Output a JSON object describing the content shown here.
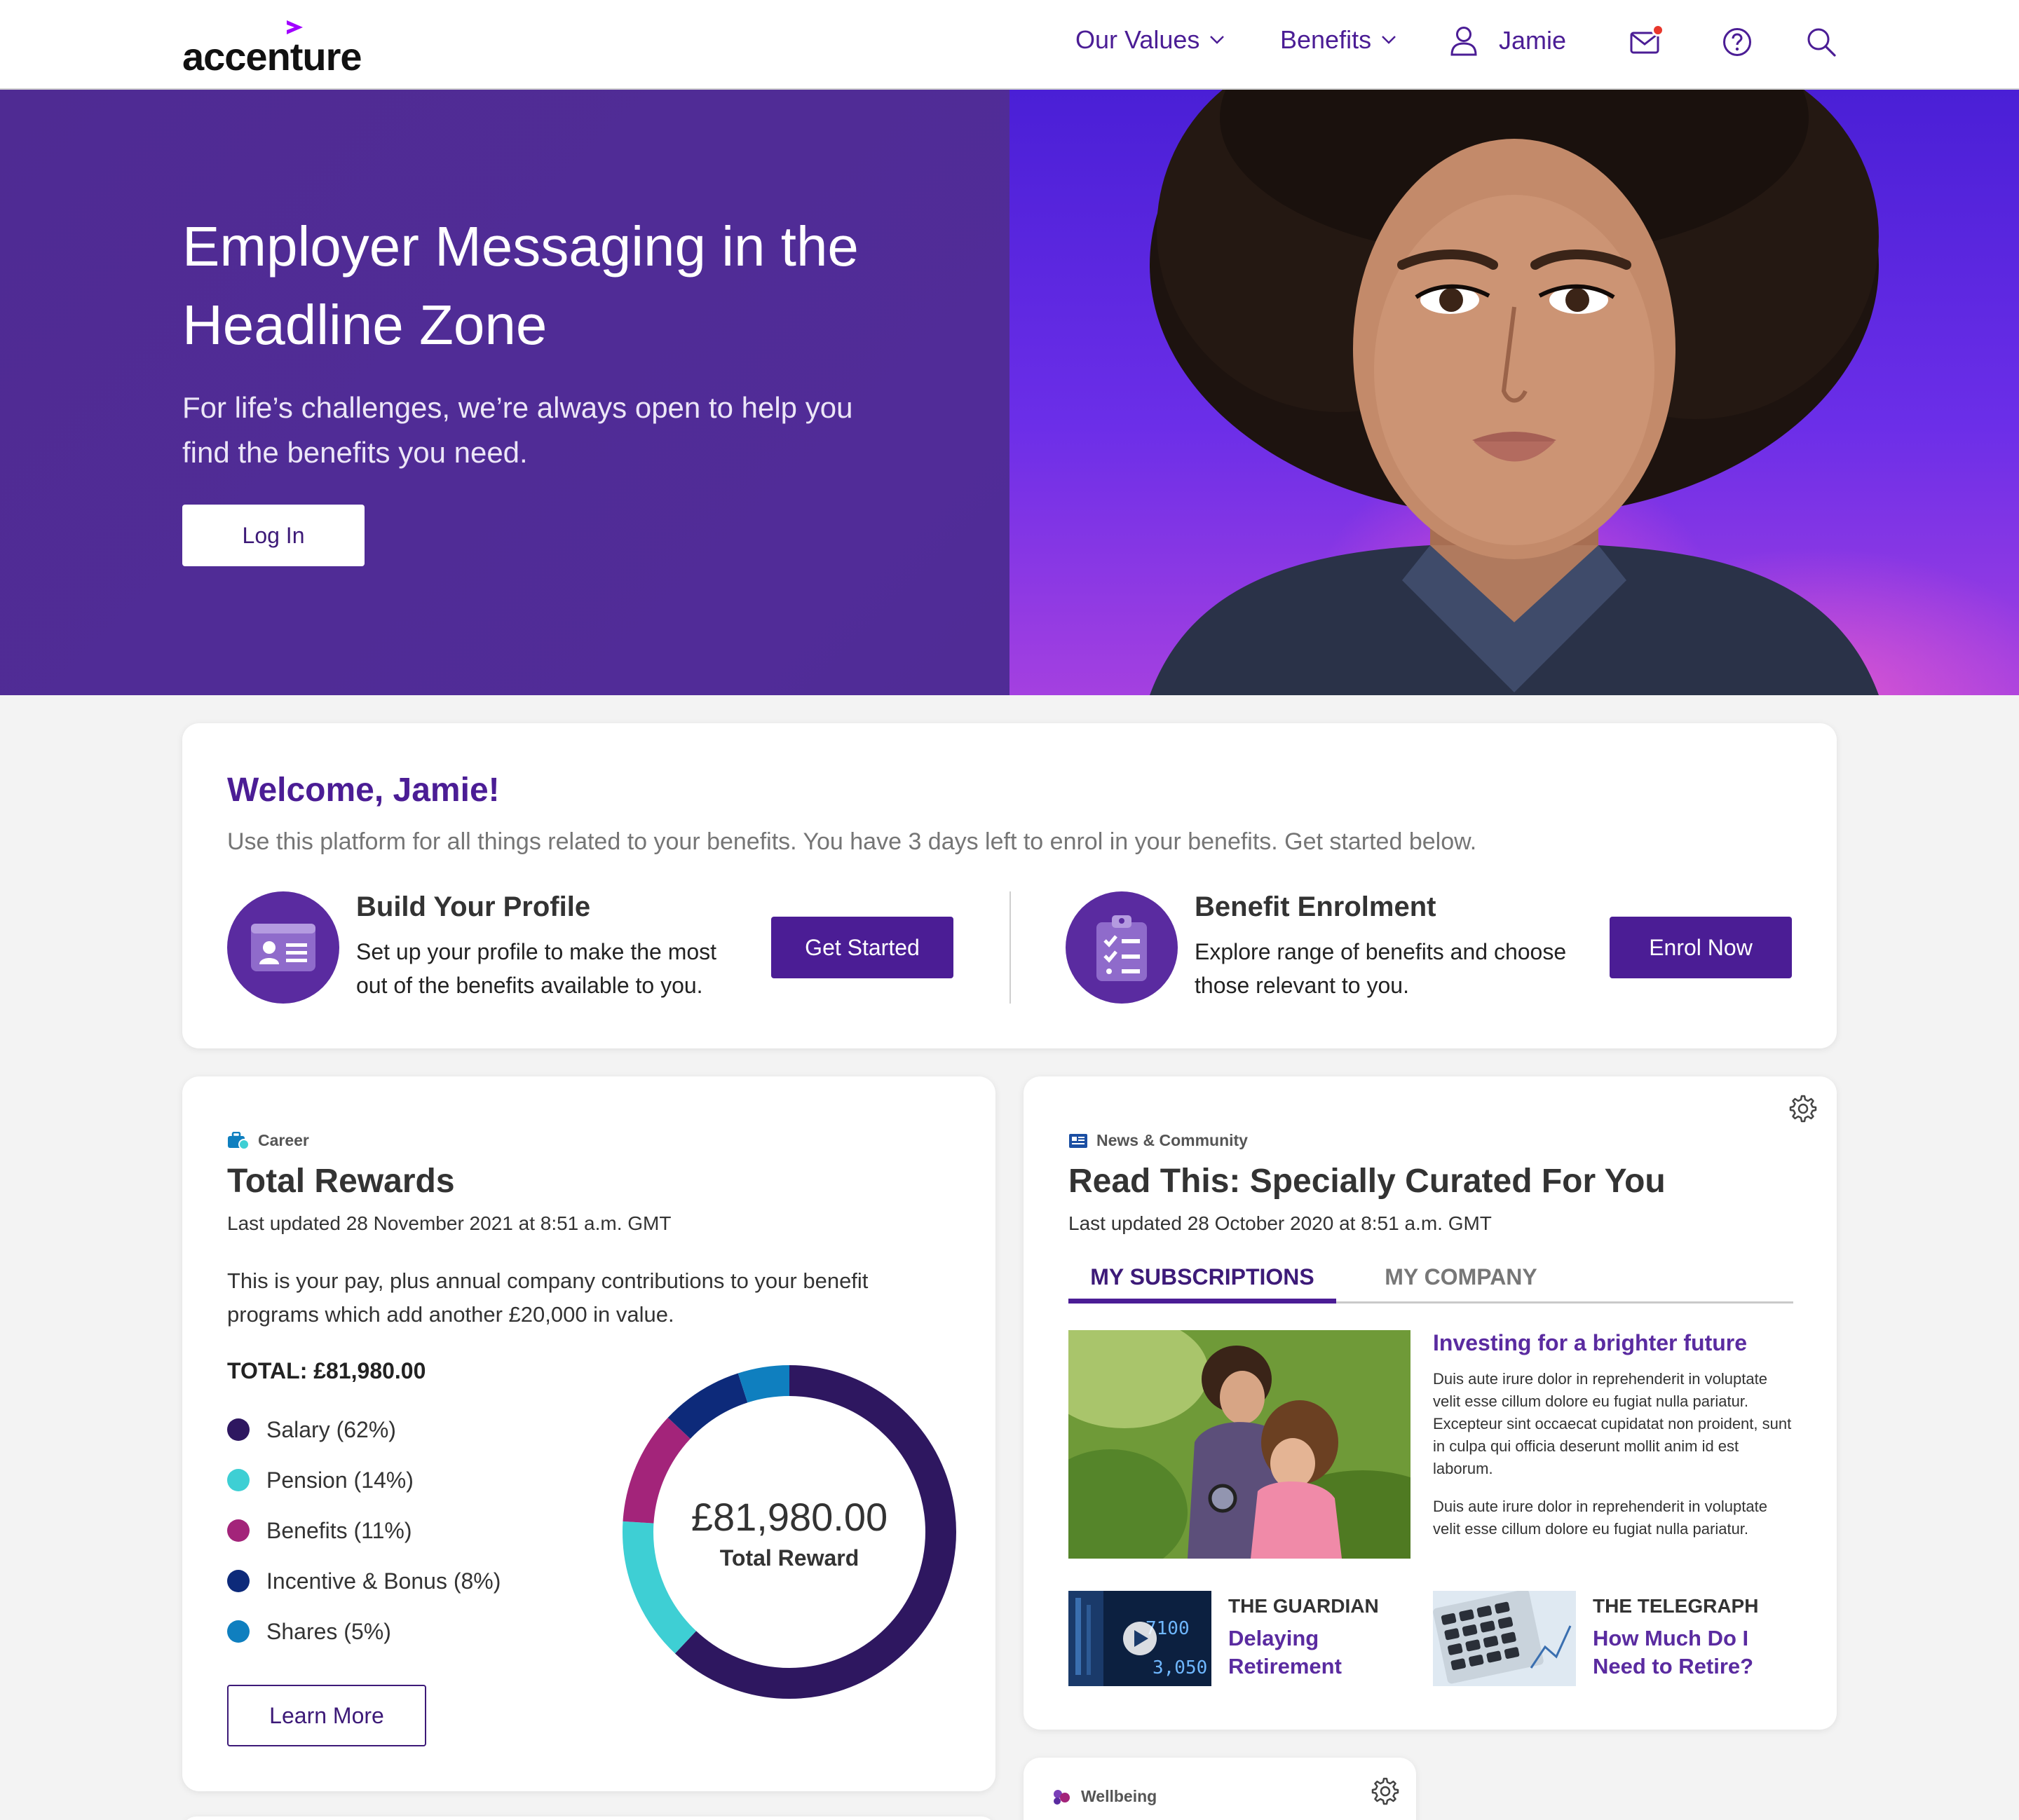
{
  "header": {
    "logo_text": "accenture",
    "nav": [
      {
        "label": "Our Values"
      },
      {
        "label": "Benefits"
      }
    ],
    "user_name": "Jamie"
  },
  "hero": {
    "title": "Employer Messaging in the Headline Zone",
    "subtitle": "For life’s challenges, we’re always open to help you find the benefits you need.",
    "login_label": "Log In"
  },
  "welcome": {
    "title": "Welcome, Jamie!",
    "text": "Use this platform for all things related to your benefits. You have 3 days left to enrol in your benefits. Get started below.",
    "steps": [
      {
        "title": "Build Your Profile",
        "text": "Set up your profile to make the most out of the benefits available to you.",
        "button": "Get Started"
      },
      {
        "title": "Benefit Enrolment",
        "text": "Explore range of benefits and choose those relevant to you.",
        "button": "Enrol Now"
      }
    ]
  },
  "rewards": {
    "category": "Career",
    "title": "Total Rewards",
    "updated": "Last updated 28 November 2021 at 8:51 a.m. GMT",
    "intro": "This is your pay, plus annual company contributions to your benefit programs which add another £20,000 in value.",
    "total_label": "TOTAL: £81,980.00",
    "center_value": "£81,980.00",
    "center_label": "Total Reward",
    "learn_more": "Learn More",
    "items": [
      {
        "label": "Salary (62%)",
        "percent": 62,
        "color": "#2e1760"
      },
      {
        "label": "Pension (14%)",
        "percent": 14,
        "color": "#3ecfd4"
      },
      {
        "label": "Benefits (11%)",
        "percent": 11,
        "color": "#a3247a"
      },
      {
        "label": "Incentive & Bonus (8%)",
        "percent": 8,
        "color": "#0d2a7a"
      },
      {
        "label": "Shares (5%)",
        "percent": 5,
        "color": "#0f7fbf"
      }
    ]
  },
  "news": {
    "category": "News & Community",
    "title": "Read This: Specially Curated For You",
    "updated": "Last updated 28 October 2020 at 8:51 a.m. GMT",
    "tabs": [
      {
        "label": "MY SUBSCRIPTIONS",
        "active": true
      },
      {
        "label": "MY COMPANY",
        "active": false
      }
    ],
    "feature": {
      "title": "Investing for a brighter future",
      "p1": "Duis aute irure dolor in reprehenderit in voluptate velit esse cillum dolore eu fugiat nulla pariatur. Excepteur sint occaecat cupidatat non proident, sunt in culpa qui officia deserunt mollit anim id est laborum.",
      "p2": "Duis aute irure dolor in reprehenderit in voluptate velit esse cillum dolore eu fugiat nulla pariatur."
    },
    "articles": [
      {
        "source": "THE GUARDIAN",
        "title": "Delaying Retirement"
      },
      {
        "source": "THE TELEGRAPH",
        "title": "How Much Do I Need to Retire?"
      }
    ]
  },
  "wellbeing": {
    "category": "Wellbeing"
  },
  "colors": {
    "brand_purple": "#4b1d95",
    "hero_bg": "#512c98",
    "notification": "#e8372c"
  }
}
